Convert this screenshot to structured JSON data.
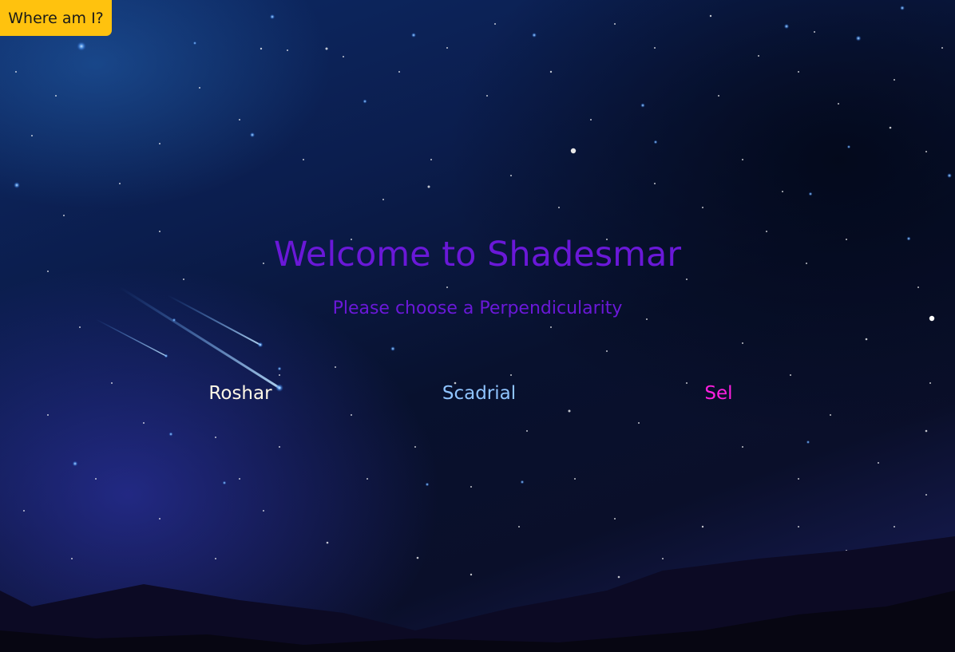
{
  "help": {
    "label": "Where am I?"
  },
  "hero": {
    "title": "Welcome to Shadesmar",
    "subtitle": "Please choose a Perpendicularity"
  },
  "perpendicularities": [
    {
      "label": "Roshar",
      "color": "#fff8e6"
    },
    {
      "label": "Scadrial",
      "color": "#8fc4ff"
    },
    {
      "label": "Sel",
      "color": "#ff1fe0"
    }
  ],
  "theme": {
    "accent_help_button": "#ffc20e",
    "title_color": "#6a18d8",
    "background": "#0b1d4d"
  }
}
